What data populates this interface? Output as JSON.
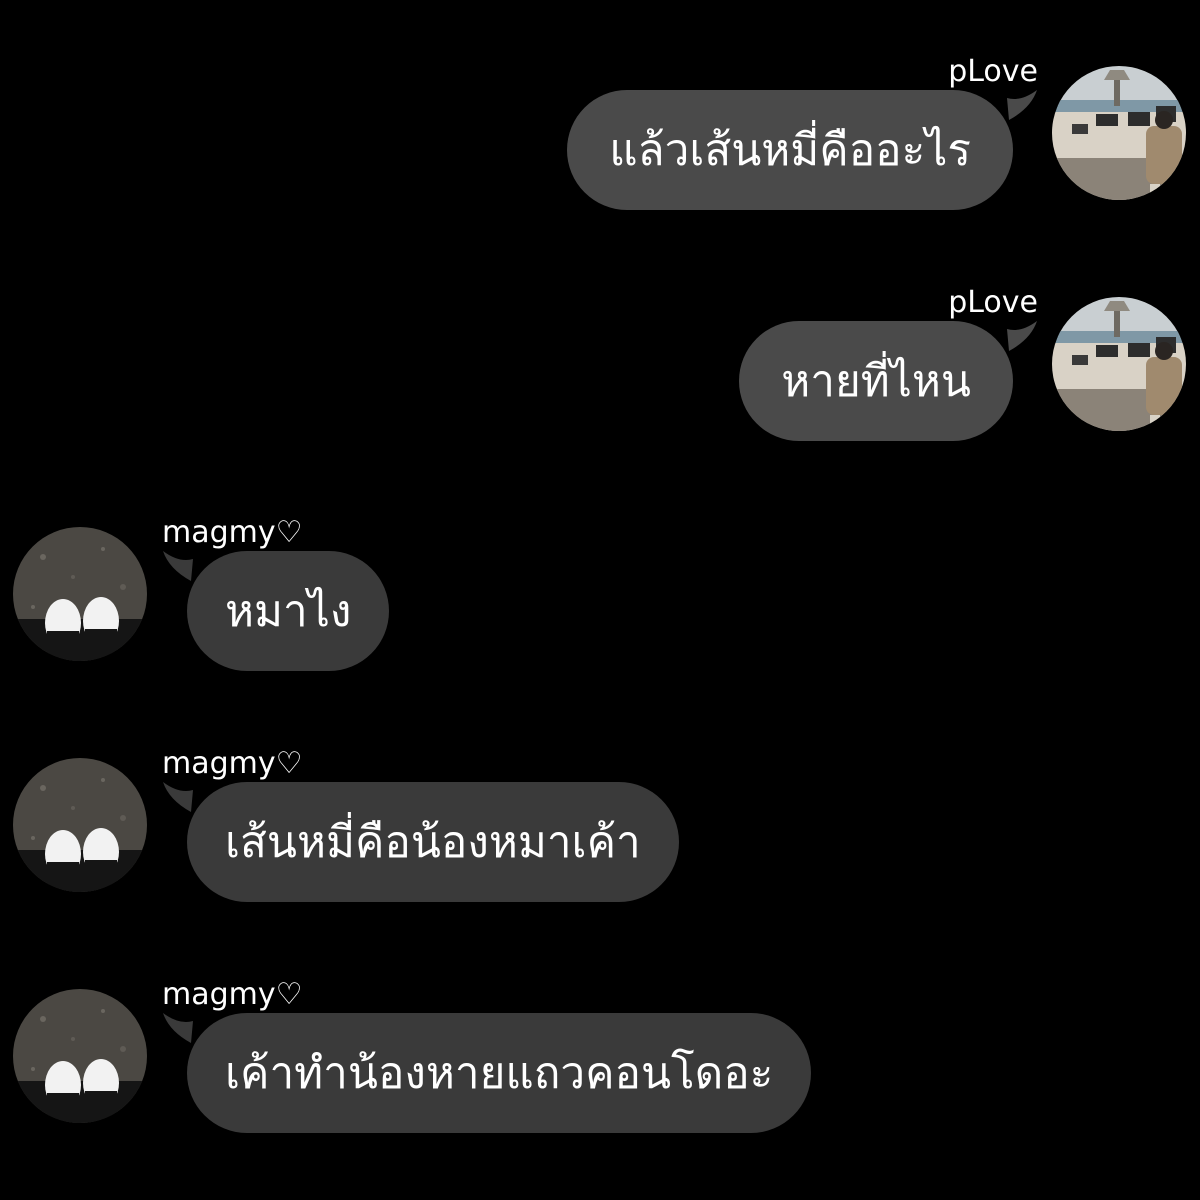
{
  "theme": {
    "background": "#000000",
    "bubble_out": "#4a4a4a",
    "bubble_in": "#3a3a3a",
    "text": "#ffffff"
  },
  "messages": [
    {
      "sender": "pLove",
      "text": "แล้วเส้นหมี่คืออะไร",
      "side": "out",
      "avatar": "beach-photo-avatar"
    },
    {
      "sender": "pLove",
      "text": "หายที่ไหน",
      "side": "out",
      "avatar": "beach-photo-avatar"
    },
    {
      "sender": "magmy♡",
      "text": "หมาไง",
      "side": "in",
      "avatar": "sneakers-photo-avatar"
    },
    {
      "sender": "magmy♡",
      "text": "เส้นหมี่คือน้องหมาเค้า",
      "side": "in",
      "avatar": "sneakers-photo-avatar"
    },
    {
      "sender": "magmy♡",
      "text": "เค้าทำน้องหายแถวคอนโดอะ",
      "side": "in",
      "avatar": "sneakers-photo-avatar"
    }
  ]
}
